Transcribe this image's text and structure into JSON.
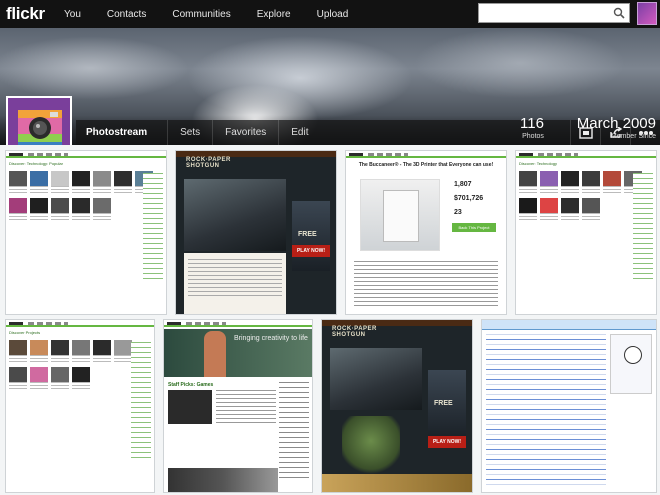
{
  "app": {
    "logo": "flickr"
  },
  "nav": {
    "items": [
      "You",
      "Contacts",
      "Communities",
      "Explore",
      "Upload"
    ]
  },
  "search": {
    "placeholder": "",
    "value": ""
  },
  "profile": {
    "photos_count": "116",
    "photos_label": "Photos",
    "member_since": "March 2009",
    "member_since_label": "Member Since"
  },
  "subnav": {
    "tabs": [
      "Photostream",
      "Sets",
      "Favorites",
      "Edit"
    ],
    "active": "Photostream"
  },
  "thumbs": {
    "t3_title": "The Buccaneer® - The 3D Printer that Everyone can use!",
    "t3_backers": "1,807",
    "t3_pledged": "$701,726",
    "t3_days": "23",
    "t3_cta": "Back This Project",
    "t2_play": "PLAY NOW!",
    "t2_free": "FREE",
    "t7_play": "PLAY NOW!",
    "t7_free": "FREE",
    "t2_heading": "Respond to our poker",
    "t6_heading": "Staff Picks: Games",
    "t6_tagline": "Bringing creativity to life"
  },
  "colors": {
    "topbar": "#121212",
    "kickstarter_green": "#65b741",
    "flickr_bg": "#f3f5f6"
  }
}
